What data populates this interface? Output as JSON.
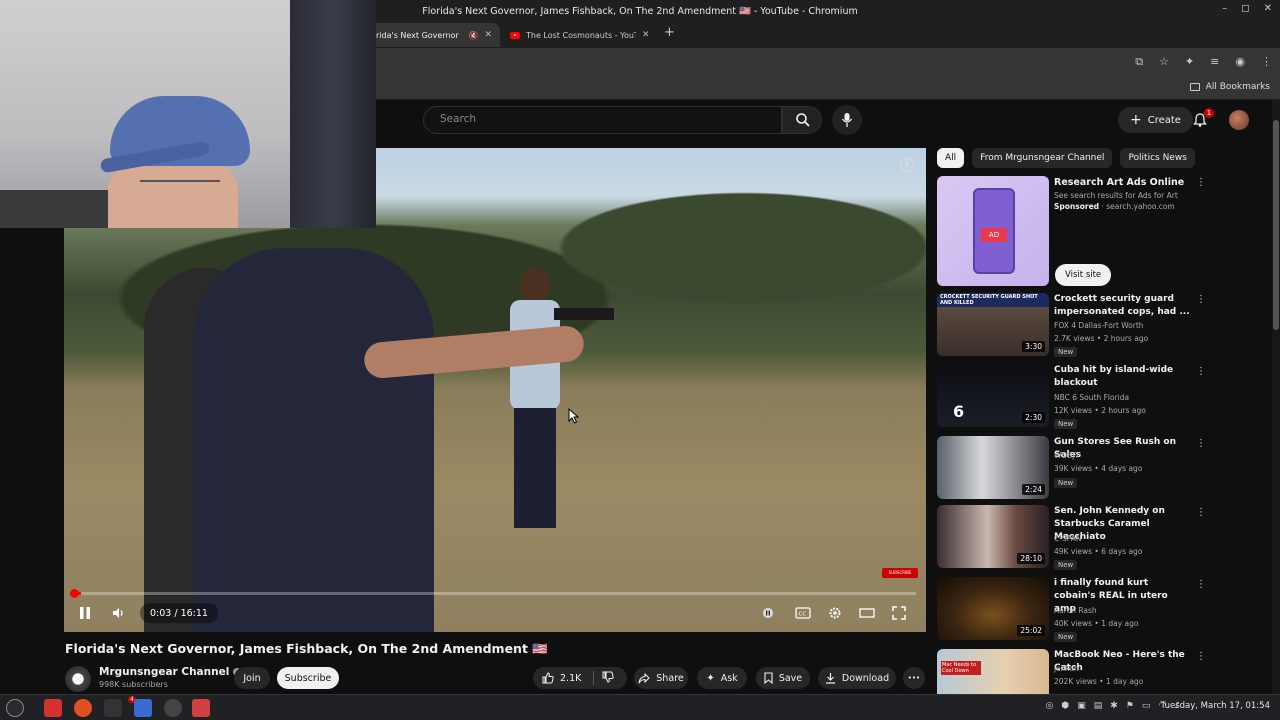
{
  "window": {
    "title": "Florida's Next Governor, James Fishback, On The 2nd Amendment 🇺🇸 - YouTube - Chromium",
    "controls": [
      "–",
      "◻",
      "✕"
    ]
  },
  "tabs": [
    {
      "title": "rida's Next Governor",
      "active": true,
      "muted_icon": "🔇",
      "close": "✕"
    },
    {
      "title": "The Lost Cosmonauts - YouTu",
      "active": false,
      "close": "✕"
    }
  ],
  "new_tab": "+",
  "bookmarks": {
    "all_label": "All Bookmarks"
  },
  "header": {
    "search_placeholder": "Search",
    "create_label": "Create",
    "notification_count": "1"
  },
  "player": {
    "time": "0:03 / 16:11",
    "progress_fraction": 0.003,
    "subscribe_watermark": "SUBSCRIBE"
  },
  "video": {
    "title": "Florida's Next Governor, James Fishback, On The 2nd Amendment 🇺🇸",
    "channel": "Mrgunsngear Channel",
    "subscribers": "998K subscribers",
    "join_label": "Join",
    "subscribe_label": "Subscribe",
    "likes": "2.1K",
    "share_label": "Share",
    "ask_label": "Ask",
    "save_label": "Save",
    "download_label": "Download",
    "more_label": "•••"
  },
  "chips": [
    "All",
    "From Mrgunsngear Channel",
    "Politics News"
  ],
  "ad": {
    "title": "Research Art Ads Online",
    "desc": "See search results for Ads for Art",
    "sponsored": "Sponsored",
    "domain": "· search.yahoo.com",
    "ad_badge": "AD",
    "visit_label": "Visit site"
  },
  "recommendations": [
    {
      "title": "Crockett security guard impersonated cops, had ...",
      "channel": "FOX 4 Dallas-Fort Worth",
      "meta": "2.7K views • 2 hours ago",
      "badge": "New",
      "duration": "3:30",
      "thumb_text": "CROCKETT SECURITY GUARD SHOT AND KILLED"
    },
    {
      "title": "Cuba hit by island-wide blackout",
      "channel": "NBC 6 South Florida",
      "meta": "12K views • 2 hours ago",
      "badge": "New",
      "duration": "2:30",
      "thumb_text": "6"
    },
    {
      "title": "Gun Stores See Rush on Sales",
      "channel": "WDBJ7",
      "meta": "39K views • 4 days ago",
      "badge": "New",
      "duration": "2:24"
    },
    {
      "title": "Sen. John Kennedy on Starbucks Caramel Macchiato",
      "channel": "C-SPAN",
      "meta": "49K views • 6 days ago",
      "badge": "New",
      "duration": "28:10"
    },
    {
      "title": "i finally found kurt cobain's REAL in utero amp",
      "channel": "Aaron Rash",
      "meta": "40K views • 1 day ago",
      "badge": "New",
      "duration": "25:02"
    },
    {
      "title": "MacBook Neo - Here's the Catch",
      "channel": "jakkuh",
      "meta": "202K views • 1 day ago",
      "badge": "",
      "duration": "",
      "thumb_text": "Mac Needs to Cool Down"
    }
  ],
  "taskbar": {
    "clock": "Tuesday, March 17, 01:54",
    "badge": "4"
  },
  "colors": {
    "youtube_red": "#ff0000",
    "background": "#0f0f0f",
    "surface": "#272727"
  }
}
